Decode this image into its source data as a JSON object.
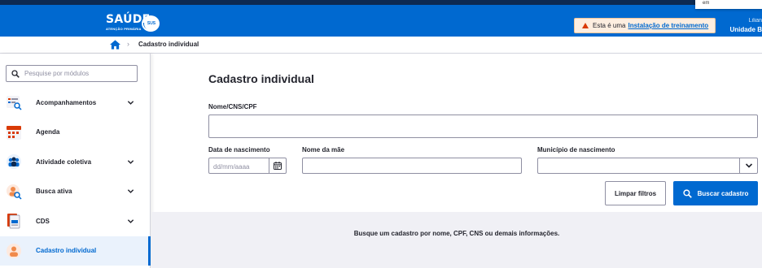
{
  "header": {
    "logo_text": "SAÚDE",
    "logo_subtitle": "ATENÇÃO PRIMÁRIA",
    "logo_badge": "SUS",
    "warning_prefix": "Esta é uma",
    "warning_link": "Instalação de treinamento",
    "user_name": "Lilian",
    "user_unit": "Unidade B",
    "popup_text": "em"
  },
  "breadcrumb": {
    "current": "Cadastro individual"
  },
  "sidebar": {
    "search_placeholder": "Pesquise por módulos",
    "items": [
      {
        "label": "Acompanhamentos",
        "icon": "checklist-search-icon",
        "expandable": true
      },
      {
        "label": "Agenda",
        "icon": "calendar-icon",
        "expandable": false
      },
      {
        "label": "Atividade coletiva",
        "icon": "group-icon",
        "expandable": true
      },
      {
        "label": "Busca ativa",
        "icon": "person-search-icon",
        "expandable": true
      },
      {
        "label": "CDS",
        "icon": "document-icon",
        "expandable": true
      },
      {
        "label": "Cadastro individual",
        "icon": "person-icon",
        "expandable": false,
        "active": true
      }
    ]
  },
  "form": {
    "title": "Cadastro individual",
    "name_label": "Nome/CNS/CPF",
    "name_value": "",
    "birth_label": "Data de nascimento",
    "birth_placeholder": "dd/mm/aaaa",
    "mother_label": "Nome da mãe",
    "mother_value": "",
    "city_label": "Município de nascimento",
    "city_value": "",
    "clear_button": "Limpar filtros",
    "search_button": "Buscar cadastro",
    "result_message": "Busque um cadastro por nome, CPF, CNS ou demais informações."
  },
  "colors": {
    "primary": "#0069d0",
    "header_dark": "#0d2a52",
    "warning_bg": "#fdeee0"
  }
}
